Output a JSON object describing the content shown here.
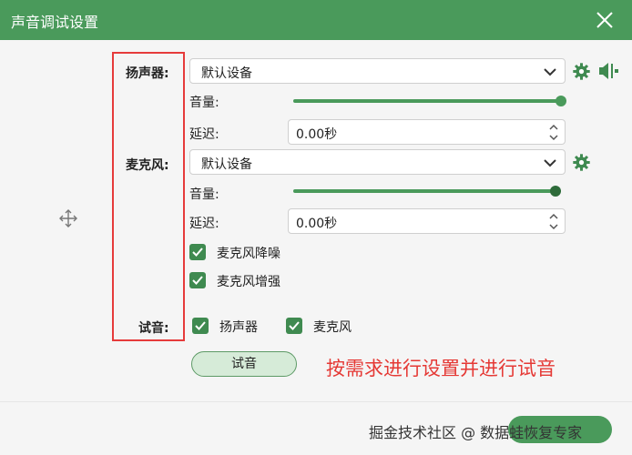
{
  "window": {
    "title": "声音调试设置",
    "accent": "#4a9a5b"
  },
  "speaker": {
    "label": "扬声器:",
    "device": "默认设备",
    "volume_label": "音量:",
    "volume_level": 1.0,
    "delay_label": "延迟:",
    "delay_value": "0.00秒"
  },
  "mic": {
    "label": "麦克风:",
    "device": "默认设备",
    "volume_label": "音量:",
    "volume_level": 0.98,
    "delay_label": "延迟:",
    "delay_value": "0.00秒",
    "noise_reduction": {
      "label": "麦克风降噪",
      "checked": true
    },
    "boost": {
      "label": "麦克风增强",
      "checked": true
    }
  },
  "test": {
    "label": "试音:",
    "speaker_option": {
      "label": "扬声器",
      "checked": true
    },
    "mic_option": {
      "label": "麦克风",
      "checked": true
    },
    "button_label": "试音"
  },
  "annotation": {
    "text": "按需求进行设置并进行试音",
    "color": "#e53935"
  },
  "watermark": {
    "text": "掘金技术社区 @ 数据蛙恢复专家"
  }
}
